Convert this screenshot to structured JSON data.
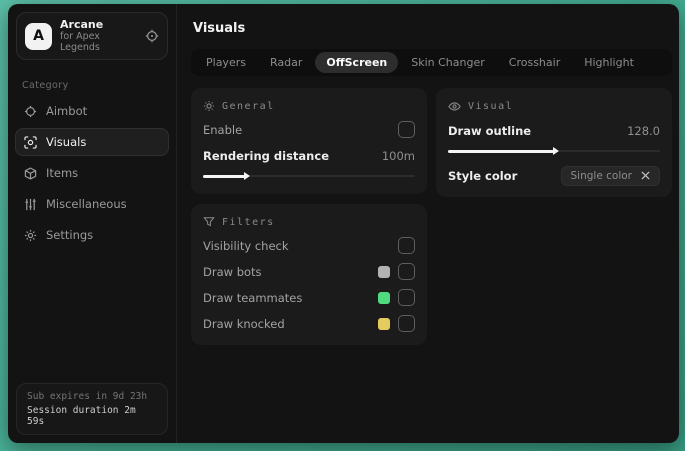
{
  "sidebar": {
    "brand": {
      "initial": "A",
      "name": "Arcane",
      "subtitle": "for Apex Legends"
    },
    "category_label": "Category",
    "items": [
      {
        "label": "Aimbot"
      },
      {
        "label": "Visuals"
      },
      {
        "label": "Items"
      },
      {
        "label": "Miscellaneous"
      },
      {
        "label": "Settings"
      }
    ],
    "session": {
      "sub_expires": "Sub expires in 9d 23h",
      "duration": "Session duration 2m 59s"
    }
  },
  "main": {
    "title": "Visuals",
    "tabs": [
      {
        "label": "Players"
      },
      {
        "label": "Radar"
      },
      {
        "label": "OffScreen",
        "active": true
      },
      {
        "label": "Skin Changer"
      },
      {
        "label": "Crosshair"
      },
      {
        "label": "Highlight"
      }
    ],
    "panels": {
      "general": {
        "title": "General",
        "enable_label": "Enable",
        "enable_checked": false,
        "rendering_distance_label": "Rendering distance",
        "rendering_distance_value": "100m",
        "rendering_distance_percent": 20
      },
      "visual": {
        "title": "Visual",
        "draw_outline_label": "Draw outline",
        "draw_outline_value": "128.0",
        "draw_outline_percent": 50,
        "style_color_label": "Style color",
        "style_color_selected": "Single color"
      },
      "filters": {
        "title": "Filters",
        "rows": [
          {
            "label": "Visibility check",
            "checked": false
          },
          {
            "label": "Draw bots",
            "swatch": "#b3b3b3",
            "checked": false
          },
          {
            "label": "Draw teammates",
            "swatch": "#4fdb7d",
            "checked": false
          },
          {
            "label": "Draw knocked",
            "swatch": "#e6cb5f",
            "checked": false
          }
        ]
      }
    }
  },
  "colors": {
    "accent_background": "#43ac92",
    "window_background": "#131313",
    "panel_background": "#1b1b1b",
    "active_tab_background": "#2d2d2d",
    "swatch_bots": "#b3b3b3",
    "swatch_teammates": "#4fdb7d",
    "swatch_knocked": "#e6cb5f"
  }
}
